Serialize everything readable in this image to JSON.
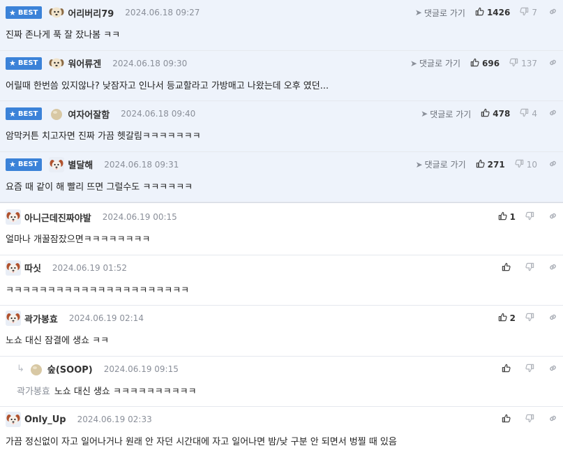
{
  "labels": {
    "best": "BEST",
    "goto": "댓글로 가기"
  },
  "comments": [
    {
      "type": "best",
      "nick": "어리버리79",
      "date": "2024.06.18 09:27",
      "likes": "1426",
      "dislikes": "7",
      "body": "진짜 존나게 푹 잘 잤나봄 ㅋㅋ",
      "avatar": "puppy-avatar"
    },
    {
      "type": "best",
      "nick": "워어류겐",
      "date": "2024.06.18 09:30",
      "likes": "696",
      "dislikes": "137",
      "body": "어릴때 한번씀 있지않나? 낮잠자고 인나서 등교할라고 가방매고 나왔는데 오후 였던...",
      "avatar": "puppy-avatar"
    },
    {
      "type": "best",
      "nick": "여자어잘함",
      "date": "2024.06.18 09:40",
      "likes": "478",
      "dislikes": "4",
      "body": "암막커튼 치고자면 진짜 가끔 헷갈림ㅋㅋㅋㅋㅋㅋㅋ",
      "avatar": "egg-avatar"
    },
    {
      "type": "best",
      "nick": "별달해",
      "date": "2024.06.18 09:31",
      "likes": "271",
      "dislikes": "10",
      "body": "요즘 때 같이 해 빨리 뜨면 그럴수도 ㅋㅋㅋㅋㅋㅋ",
      "avatar": "dog-avatar"
    },
    {
      "type": "normal",
      "nick": "아니근데진짜야발",
      "date": "2024.06.19 00:15",
      "likes": "1",
      "dislikes": "",
      "body": "얼마나 개꿀잠잤으면ㅋㅋㅋㅋㅋㅋㅋㅋ",
      "avatar": "dog-avatar"
    },
    {
      "type": "normal",
      "nick": "따싯",
      "date": "2024.06.19 01:52",
      "likes": "",
      "dislikes": "",
      "body": "ㅋㅋㅋㅋㅋㅋㅋㅋㅋㅋㅋㅋㅋㅋㅋㅋㅋㅋㅋㅋㅋㅋ",
      "avatar": "dog-avatar"
    },
    {
      "type": "normal",
      "nick": "곽가봉효",
      "date": "2024.06.19 02:14",
      "likes": "2",
      "dislikes": "",
      "body": "노쇼 대신 잠결에 생쇼 ㅋㅋ",
      "avatar": "dog-avatar"
    },
    {
      "type": "reply",
      "nick": "숲(SOOP)",
      "date": "2024.06.19 09:15",
      "likes": "",
      "dislikes": "",
      "mention": "곽가봉효",
      "body": "노쇼 대신 생쇼 ㅋㅋㅋㅋㅋㅋㅋㅋㅋㅋ",
      "avatar": "egg-avatar"
    },
    {
      "type": "normal",
      "nick": "Only_Up",
      "date": "2024.06.19 02:33",
      "likes": "",
      "dislikes": "",
      "body": "가끔 정신없이 자고 일어나거나 원래 안 자던 시간대에 자고 일어나면 밤/낮 구분 안 되면서 벙찔 때 있음",
      "avatar": "dog-avatar"
    }
  ]
}
